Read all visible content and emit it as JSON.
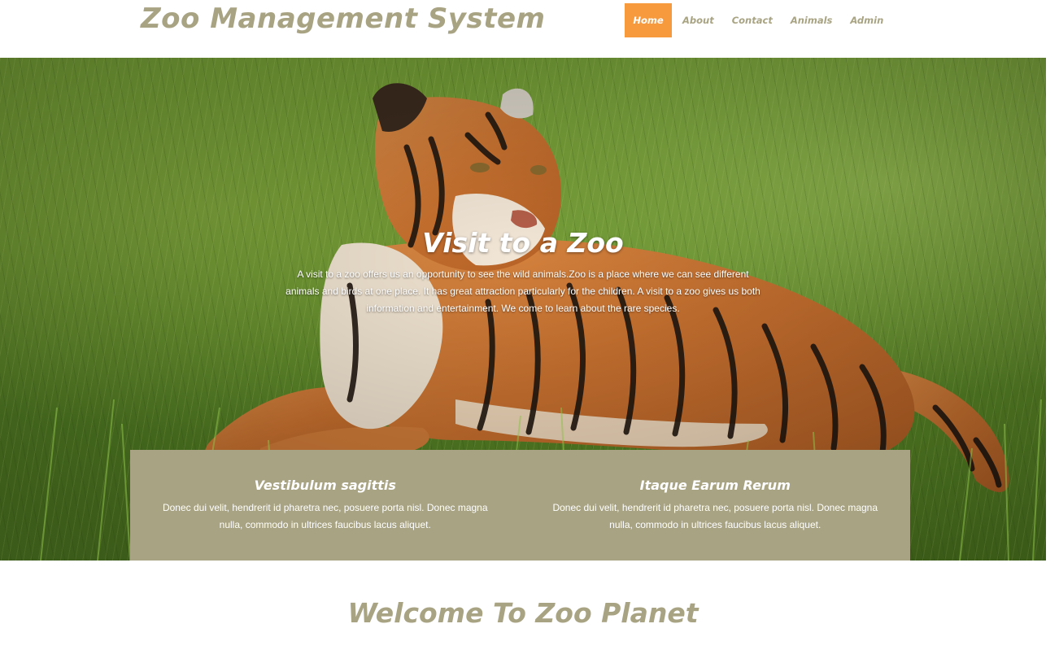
{
  "site": {
    "title": "Zoo Management System",
    "brand_color": "#a8a382",
    "accent_color": "#f79a3e"
  },
  "nav": {
    "items": [
      {
        "label": "Home",
        "active": true
      },
      {
        "label": "About",
        "active": false
      },
      {
        "label": "Contact",
        "active": false
      },
      {
        "label": "Animals",
        "active": false
      },
      {
        "label": "Admin",
        "active": false
      }
    ]
  },
  "hero": {
    "image": "tiger-in-grass",
    "title": "Visit to a Zoo",
    "text": "A visit to a zoo offers us an opportunity to see the wild animals.Zoo is a place where we can see different animals and birds at one place. It has great attraction particularly for the children. A visit to a zoo gives us both information and entertainment. We come to learn about the rare species."
  },
  "features": [
    {
      "title": "Vestibulum sagittis",
      "text": "Donec dui velit, hendrerit id pharetra nec, posuere porta nisl. Donec magna nulla, commodo in ultrices faucibus lacus aliquet."
    },
    {
      "title": "Itaque Earum Rerum",
      "text": "Donec dui velit, hendrerit id pharetra nec, posuere porta nisl. Donec magna nulla, commodo in ultrices faucibus lacus aliquet."
    }
  ],
  "welcome": {
    "title": "Welcome To Zoo Planet"
  }
}
